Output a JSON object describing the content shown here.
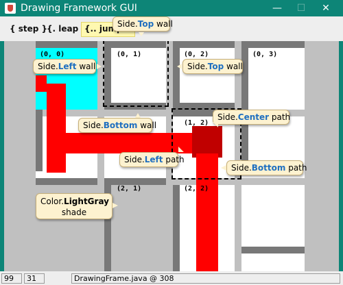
{
  "window": {
    "title": "Drawing Framework GUI",
    "icon": "java-cup-icon",
    "controls": {
      "minimize": "—",
      "maximize": "☐",
      "close": "✕"
    }
  },
  "toolbar": {
    "step_label": "{ step }",
    "leap_label": "{. leap .}",
    "jump_label": "{.. jump .."
  },
  "grid": {
    "coords": {
      "c00": "(0, 0)",
      "c01": "(0, 1)",
      "c02": "(0, 2)",
      "c03": "(0, 3)",
      "c12": "(1, 2)",
      "c21": "(2, 1)",
      "c22": "(2, 2)"
    }
  },
  "annotations": {
    "top_wall": {
      "prefix": "Side.",
      "keyword": "Top",
      "suffix": " wall"
    },
    "left_wall": {
      "prefix": "Side.",
      "keyword": "Left",
      "suffix": " wall"
    },
    "top_wall_2": {
      "prefix": "Side.",
      "keyword": "Top",
      "suffix": " wall"
    },
    "bottom_wall": {
      "prefix": "Side.",
      "keyword": "Bottom",
      "suffix": " wall"
    },
    "center_path": {
      "prefix": "Side.",
      "keyword": "Center",
      "suffix": "  path"
    },
    "left_path": {
      "prefix": "Side.",
      "keyword": "Left",
      "suffix": " path"
    },
    "bottom_path": {
      "prefix": "Side.",
      "keyword": "Bottom",
      "suffix": " path"
    },
    "lightgray": {
      "line1_prefix": "Color.",
      "line1_keyword": "LightGray",
      "line2": "shade"
    }
  },
  "status": {
    "field1": "99",
    "field2": "31",
    "field3": "DrawingFrame.java @ 308"
  },
  "colors": {
    "titlebar": "#0d8577",
    "path": "#ff0000",
    "center": "#c00000",
    "wall": "#787878",
    "cyan": "#00ffff",
    "lightgray": "#c0c0c0",
    "keyword": "#1f6fc0"
  }
}
